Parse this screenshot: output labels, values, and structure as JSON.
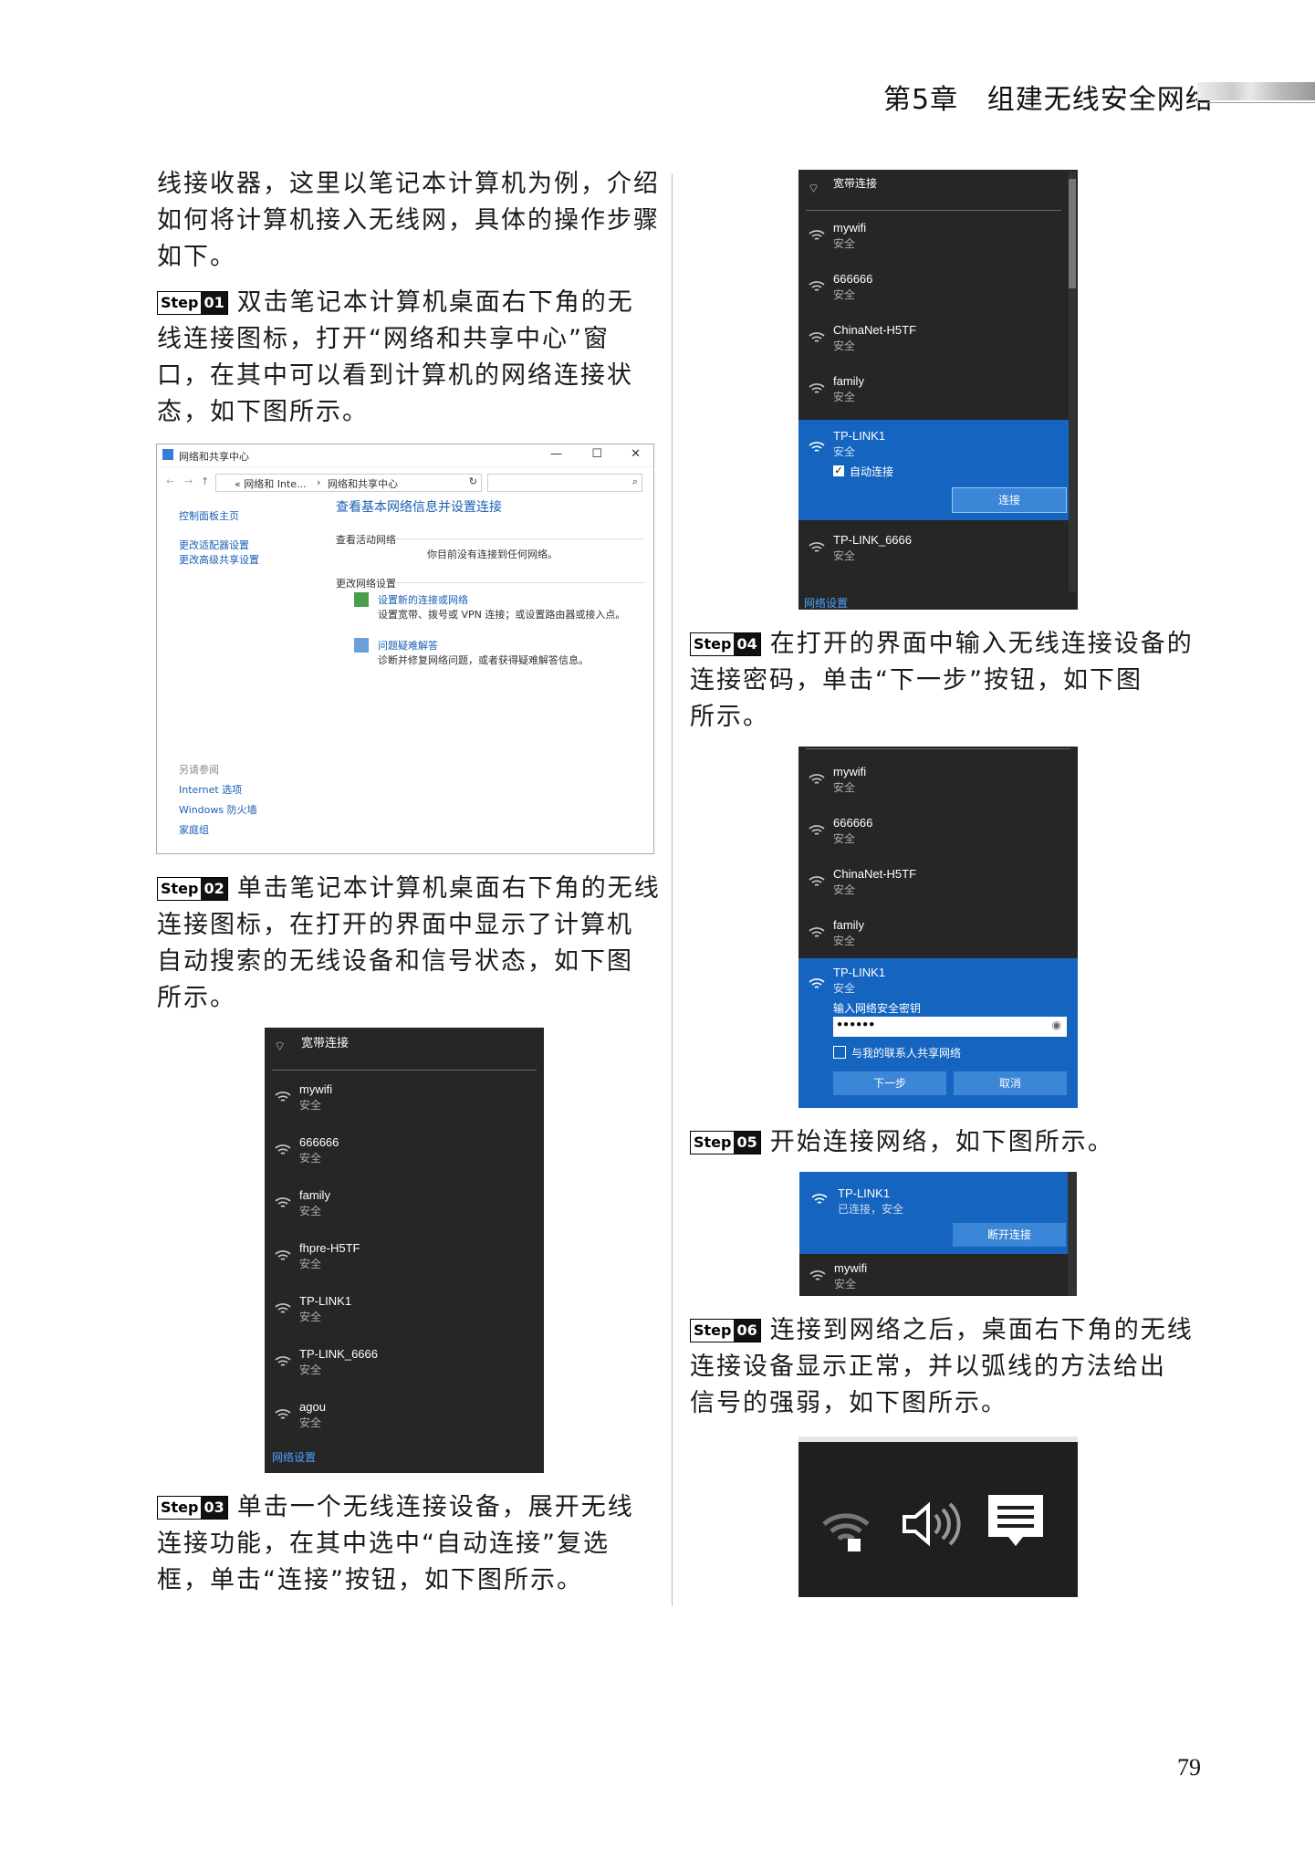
{
  "header": {
    "chapter": "第5章",
    "title": "组建无线安全网络"
  },
  "left": {
    "intro": [
      "线接收器，这里以笔记本计算机为例，介绍",
      "如何将计算机接入无线网，具体的操作步骤",
      "如下。"
    ],
    "step01": {
      "label": "Step",
      "num": "01",
      "lines": [
        "双击笔记本计算机桌面右下角的无",
        "线连接图标，打开“网络和共享中心”窗",
        "口，在其中可以看到计算机的网络连接状",
        "态，如下图所示。"
      ]
    },
    "step02": {
      "label": "Step",
      "num": "02",
      "lines": [
        "单击笔记本计算机桌面右下角的无线",
        "连接图标，在打开的界面中显示了计算机",
        "自动搜索的无线设备和信号状态，如下图",
        "所示。"
      ]
    },
    "step03": {
      "label": "Step",
      "num": "03",
      "lines": [
        "单击一个无线连接设备，展开无线",
        "连接功能，在其中选中“自动连接”复选",
        "框，单击“连接”按钮，如下图所示。"
      ]
    }
  },
  "right": {
    "step04": {
      "label": "Step",
      "num": "04",
      "lines": [
        "在打开的界面中输入无线连接设备的",
        "连接密码，单击“下一步”按钮，如下图",
        "所示。"
      ]
    },
    "step05": {
      "label": "Step",
      "num": "05",
      "lines": [
        "开始连接网络，如下图所示。"
      ]
    },
    "step06": {
      "label": "Step",
      "num": "06",
      "lines": [
        "连接到网络之后，桌面右下角的无线",
        "连接设备显示正常，并以弧线的方法给出",
        "信号的强弱，如下图所示。"
      ]
    }
  },
  "win": {
    "title": "网络和共享中心",
    "path1": "« 网络和 Inte...",
    "path2": "网络和共享中心",
    "side": [
      "控制面板主页",
      "更改适配器设置",
      "更改高级共享设置"
    ],
    "heading": "查看基本网络信息并设置连接",
    "active_label": "查看活动网络",
    "active_text": "你目前没有连接到任何网络。",
    "change_label": "更改网络设置",
    "item1_title": "设置新的连接或网络",
    "item1_desc": "设置宽带、拨号或 VPN 连接；或设置路由器或接入点。",
    "item2_title": "问题疑难解答",
    "item2_desc": "诊断并修复网络问题，或者获得疑难解答信息。",
    "see_also": "另请参阅",
    "links": [
      "Internet 选项",
      "Windows 防火墙",
      "家庭组"
    ],
    "controls": [
      "—",
      "☐",
      "✕"
    ]
  },
  "panel1": {
    "broadband": "宽带连接",
    "networks": [
      {
        "name": "mywifi",
        "status": "安全"
      },
      {
        "name": "666666",
        "status": "安全"
      },
      {
        "name": "family",
        "status": "安全"
      },
      {
        "name": "fhpre-H5TF",
        "status": "安全"
      },
      {
        "name": "TP-LINK1",
        "status": "安全"
      },
      {
        "name": "TP-LINK_6666",
        "status": "安全"
      },
      {
        "name": "agou",
        "status": "安全"
      }
    ],
    "settings": "网络设置"
  },
  "panel2": {
    "broadband": "宽带连接",
    "networks": [
      {
        "name": "mywifi",
        "status": "安全"
      },
      {
        "name": "666666",
        "status": "安全"
      },
      {
        "name": "ChinaNet-H5TF",
        "status": "安全"
      },
      {
        "name": "family",
        "status": "安全"
      }
    ],
    "selected": {
      "name": "TP-LINK1",
      "status": "安全",
      "auto": "自动连接",
      "connect": "连接"
    },
    "after": {
      "name": "TP-LINK_6666",
      "status": "安全"
    },
    "settings": "网络设置"
  },
  "panel3": {
    "networks": [
      {
        "name": "mywifi",
        "status": "安全"
      },
      {
        "name": "666666",
        "status": "安全"
      },
      {
        "name": "ChinaNet-H5TF",
        "status": "安全"
      },
      {
        "name": "family",
        "status": "安全"
      }
    ],
    "selected": {
      "name": "TP-LINK1",
      "status": "安全",
      "prompt": "输入网络安全密钥",
      "password": "●●●●●●",
      "share": "与我的联系人共享网络",
      "next": "下一步",
      "cancel": "取消"
    }
  },
  "panel4": {
    "connected": {
      "name": "TP-LINK1",
      "status": "已连接，安全",
      "disconnect": "断开连接"
    },
    "next": {
      "name": "mywifi",
      "status": "安全"
    }
  },
  "page_number": "79",
  "colors": {
    "dark": "#262626",
    "blue": "#1565c0",
    "link": "#1a5fb4"
  }
}
